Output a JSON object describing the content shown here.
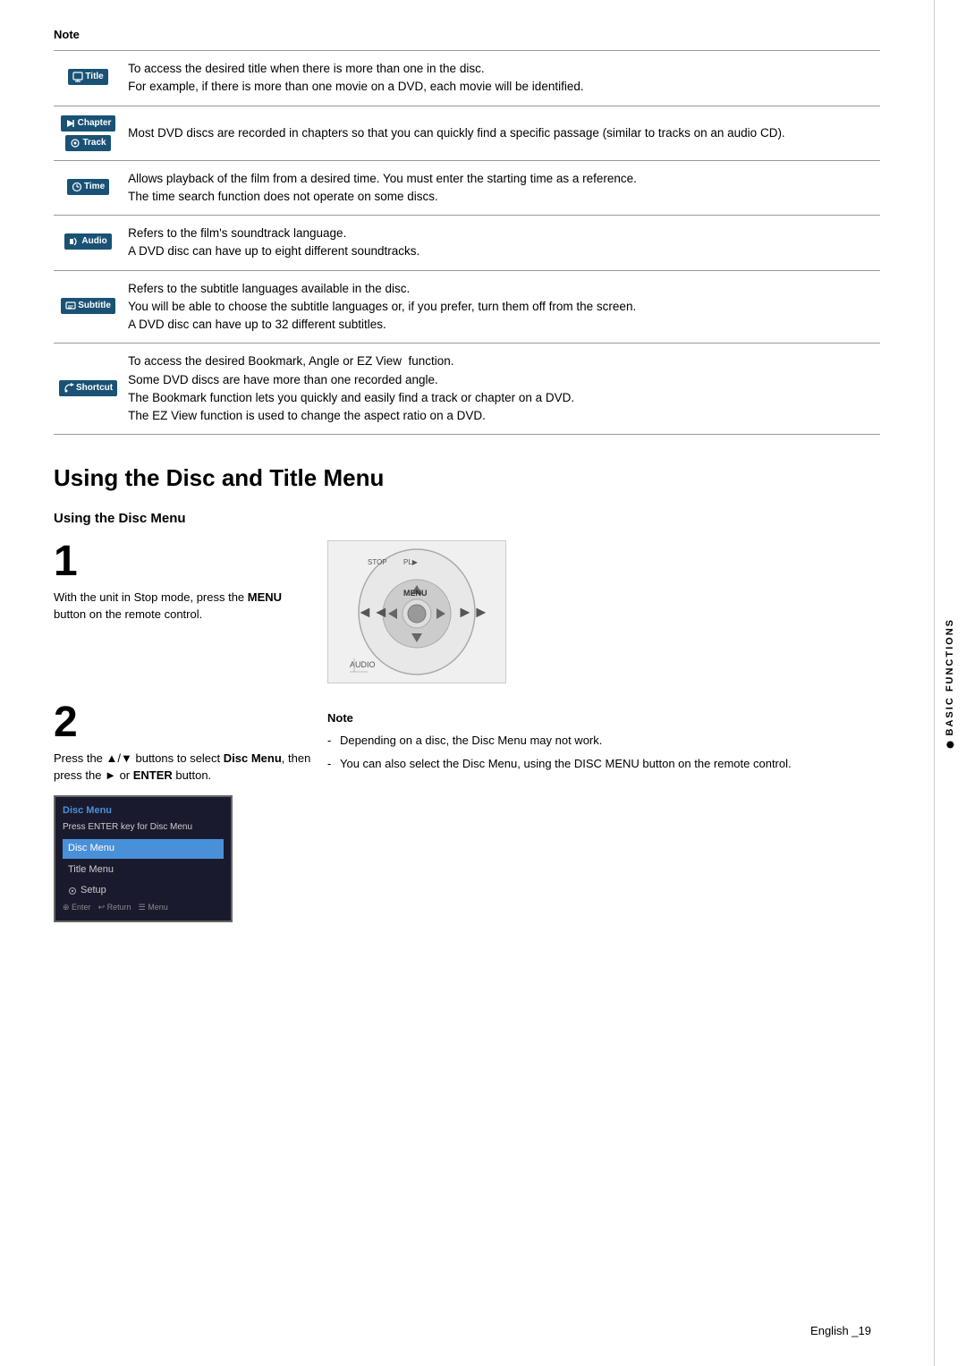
{
  "note": {
    "label": "Note",
    "rows": [
      {
        "icon_label": "Title",
        "icon_symbol": "🖥",
        "text": "To access the desired title when there is more than one in the disc.\nFor example, if there is more than one movie on a DVD, each movie will be identified."
      },
      {
        "icon_label1": "Chapter",
        "icon_label2": "Track",
        "text": "Most DVD discs are recorded in chapters so that you can quickly find a specific passage (similar to tracks on an audio CD)."
      },
      {
        "icon_label": "Time",
        "icon_symbol": "⏱",
        "text": "Allows playback of the film from a desired time. You must enter the starting time as a reference.\nThe time search function does not operate on some discs."
      },
      {
        "icon_label": "Audio",
        "icon_symbol": "🎵",
        "text": "Refers to the film's soundtrack language.\nA DVD disc can have up to eight different soundtracks."
      },
      {
        "icon_label": "Subtitle",
        "icon_symbol": "💬",
        "text": "Refers to the subtitle languages available in the disc.\nYou will be able to choose the subtitle languages or, if you prefer, turn them off from the screen.\nA DVD disc can have up to 32 different subtitles."
      },
      {
        "icon_label": "Shortcut",
        "icon_symbol": "📎",
        "text": "To access the desired Bookmark, Angle or EZ View  function.\nSome DVD discs are have more than one recorded angle.\nThe Bookmark function lets you quickly and easily find a track or chapter on a DVD.\nThe EZ View function is used to change the aspect ratio on a DVD."
      }
    ]
  },
  "section": {
    "title": "Using the Disc and Title Menu",
    "sub_title": "Using the Disc Menu"
  },
  "step1": {
    "number": "1",
    "text_parts": [
      "With the unit in Stop mode, press the ",
      "MENU",
      " button on the remote control."
    ]
  },
  "step2": {
    "number": "2",
    "text_parts": [
      "Press the ▲/▼ buttons to select ",
      "Disc Menu",
      ", then press the ► or ",
      "ENTER",
      " button."
    ],
    "note_label": "Note",
    "note_items": [
      "Depending on a disc, the Disc Menu may not work.",
      "You can also select the Disc Menu, using the DISC MENU button on the remote control."
    ]
  },
  "screen": {
    "title": "Disc Menu",
    "instruction": "Press ENTER key for Disc Menu",
    "items": [
      "Disc Menu",
      "Title Menu",
      "Setup"
    ],
    "footer": [
      "Enter",
      "Return",
      "Menu"
    ]
  },
  "sidebar": {
    "label": "BASIC FUNCTIONS"
  },
  "footer": {
    "text": "English _19"
  }
}
